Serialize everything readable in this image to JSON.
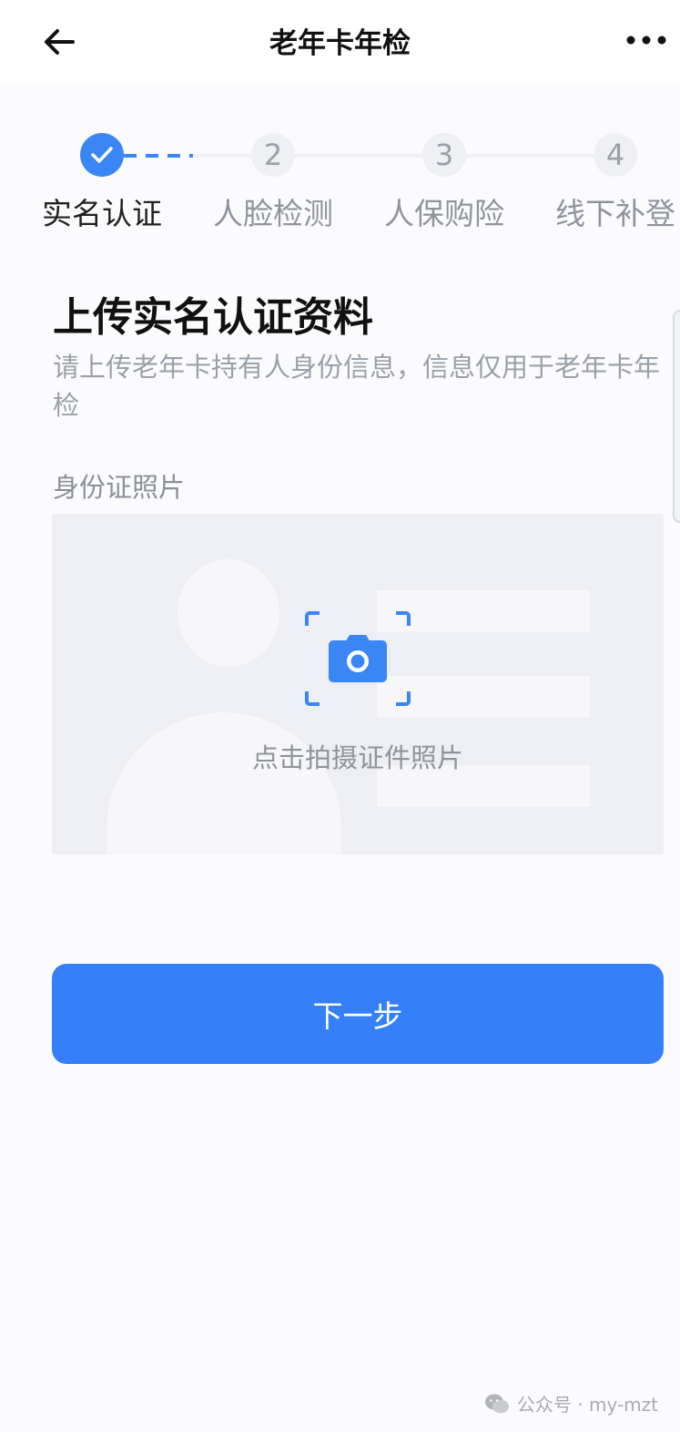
{
  "header": {
    "title": "老年卡年检"
  },
  "stepper": {
    "steps": [
      {
        "number": "1",
        "label": "实名认证",
        "status": "done"
      },
      {
        "number": "2",
        "label": "人脸检测",
        "status": "pending"
      },
      {
        "number": "3",
        "label": "人保购险",
        "status": "pending"
      },
      {
        "number": "4",
        "label": "线下补登",
        "status": "pending"
      }
    ]
  },
  "main": {
    "title": "上传实名认证资料",
    "description": "请上传老年卡持有人身份信息，信息仅用于老年卡年检",
    "id_photo_label": "身份证照片",
    "upload_hint": "点击拍摄证件照片",
    "next_button": "下一步"
  },
  "watermark": {
    "text": "公众号 · my-mzt"
  },
  "colors": {
    "accent": "#3a86f4",
    "button": "#3580f8"
  },
  "icons": [
    "back-arrow-icon",
    "more-icon",
    "check-icon",
    "camera-icon",
    "wechat-icon"
  ]
}
